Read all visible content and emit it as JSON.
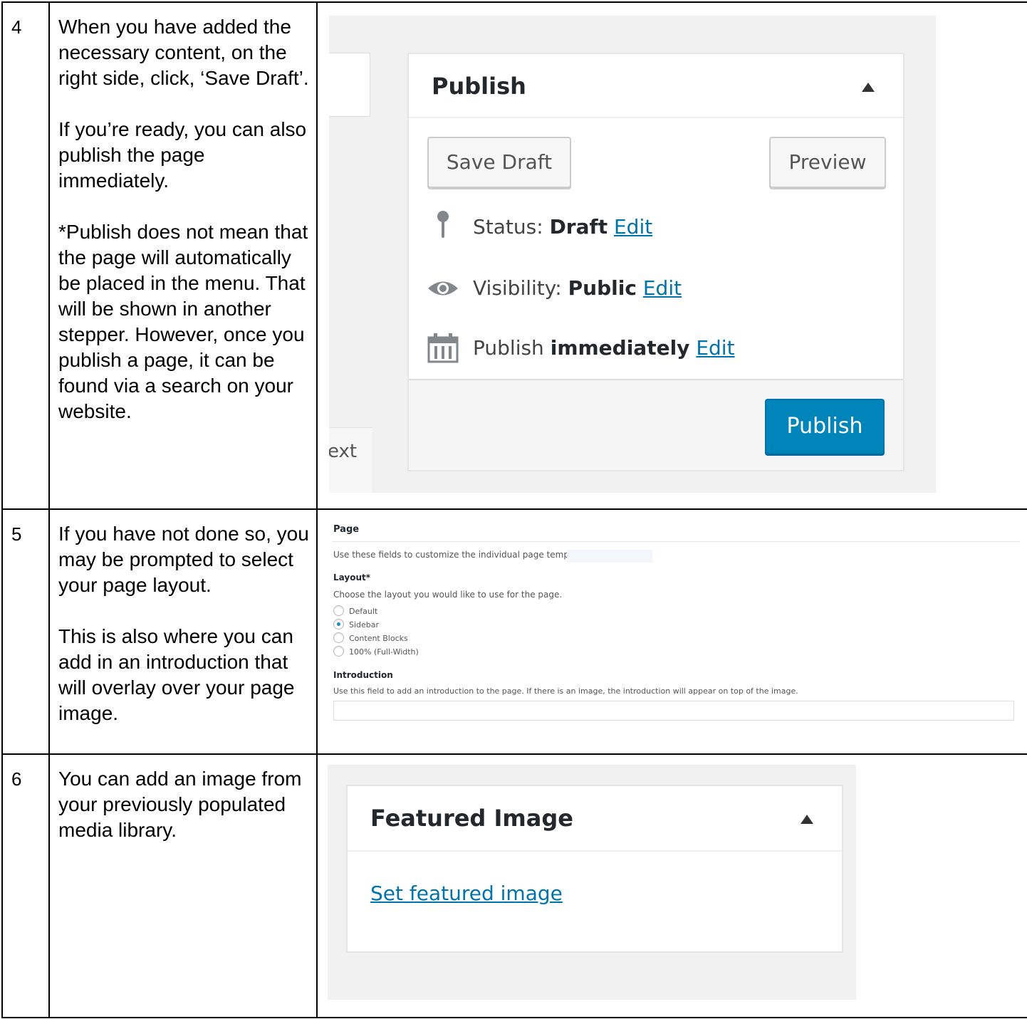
{
  "rows": [
    {
      "step": "4",
      "paragraphs": [
        "When you have added the necessary content, on the right side, click, ‘Save Draft’.",
        "If you’re ready, you can also publish the page immediately.",
        "*Publish does not mean that the page will automatically be placed in the menu. That will be shown in another stepper. However, once you publish a page, it can be found via a search on your website."
      ]
    },
    {
      "step": "5",
      "paragraphs": [
        "If you have not done so, you may be prompted to select your page layout.",
        "This is also where you can add in an introduction that will overlay over your page image."
      ]
    },
    {
      "step": "6",
      "paragraphs": [
        "You can add an image from your previously populated media library."
      ]
    }
  ],
  "publish_box": {
    "side_text": "ext",
    "title": "Publish",
    "save_draft_label": "Save Draft",
    "preview_label": "Preview",
    "status_label": "Status:",
    "status_value": "Draft",
    "visibility_label": "Visibility:",
    "visibility_value": "Public",
    "schedule_label": "Publish",
    "schedule_value": "immediately",
    "edit_label": "Edit",
    "publish_button_label": "Publish",
    "icons": [
      "pin-icon",
      "eye-icon",
      "calendar-icon",
      "caret-up-icon"
    ]
  },
  "page_fields": {
    "section_title": "Page",
    "section_desc": "Use these fields to customize the individual page template.",
    "layout_label": "Layout*",
    "layout_desc": "Choose the layout you would like to use for the page.",
    "layout_options": [
      "Default",
      "Sidebar",
      "Content Blocks",
      "100% (Full-Width)"
    ],
    "selected_layout": "Sidebar",
    "intro_label": "Introduction",
    "intro_desc": "Use this field to add an introduction to the page. If there is an image, the introduction will appear on top of the image.",
    "intro_value": ""
  },
  "featured_image": {
    "title": "Featured Image",
    "link_label": "Set featured image"
  },
  "colors": {
    "link": "#0073aa",
    "primary_button": "#0085ba",
    "panel_bg": "#f1f1f1"
  }
}
